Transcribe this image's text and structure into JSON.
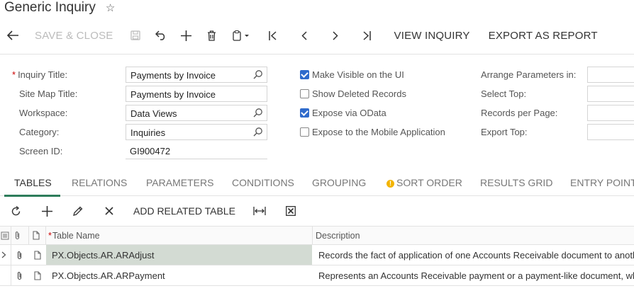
{
  "page": {
    "title": "Generic Inquiry"
  },
  "toolbar": {
    "save_close": "SAVE & CLOSE",
    "view_inquiry": "VIEW INQUIRY",
    "export_report": "EXPORT AS REPORT"
  },
  "form": {
    "inquiry_title_label": "Inquiry Title:",
    "inquiry_title_value": "Payments by Invoice",
    "site_map_title_label": "Site Map Title:",
    "site_map_title_value": "Payments by Invoice",
    "workspace_label": "Workspace:",
    "workspace_value": "Data Views",
    "category_label": "Category:",
    "category_value": "Inquiries",
    "screen_id_label": "Screen ID:",
    "screen_id_value": "GI900472",
    "make_visible_label": "Make Visible on the UI",
    "make_visible_checked": true,
    "show_deleted_label": "Show Deleted Records",
    "show_deleted_checked": false,
    "expose_odata_label": "Expose via OData",
    "expose_odata_checked": true,
    "expose_mobile_label": "Expose to the Mobile Application",
    "expose_mobile_checked": false,
    "arrange_params_label": "Arrange Parameters in:",
    "select_top_label": "Select Top:",
    "records_per_page_label": "Records per Page:",
    "export_top_label": "Export Top:"
  },
  "tabs": [
    {
      "label": "TABLES"
    },
    {
      "label": "RELATIONS"
    },
    {
      "label": "PARAMETERS"
    },
    {
      "label": "CONDITIONS"
    },
    {
      "label": "GROUPING"
    },
    {
      "label": "SORT ORDER"
    },
    {
      "label": "RESULTS GRID"
    },
    {
      "label": "ENTRY POINT"
    }
  ],
  "grid_toolbar": {
    "add_related_table": "ADD RELATED TABLE"
  },
  "grid": {
    "columns": {
      "table_name": "Table Name",
      "description": "Description"
    },
    "rows": [
      {
        "table_name": "PX.Objects.AR.ARAdjust",
        "description": "Records the fact of application of one Accounts Receivable document to another"
      },
      {
        "table_name": "PX.Objects.AR.ARPayment",
        "description": "Represents an Accounts Receivable payment or a payment-like document, which"
      }
    ]
  },
  "colors": {
    "accent": "#2e7d5b",
    "checkbox": "#2f6bcc",
    "selected_row": "#d3dbd3",
    "required": "#cc0000",
    "warning": "#f3b400"
  }
}
